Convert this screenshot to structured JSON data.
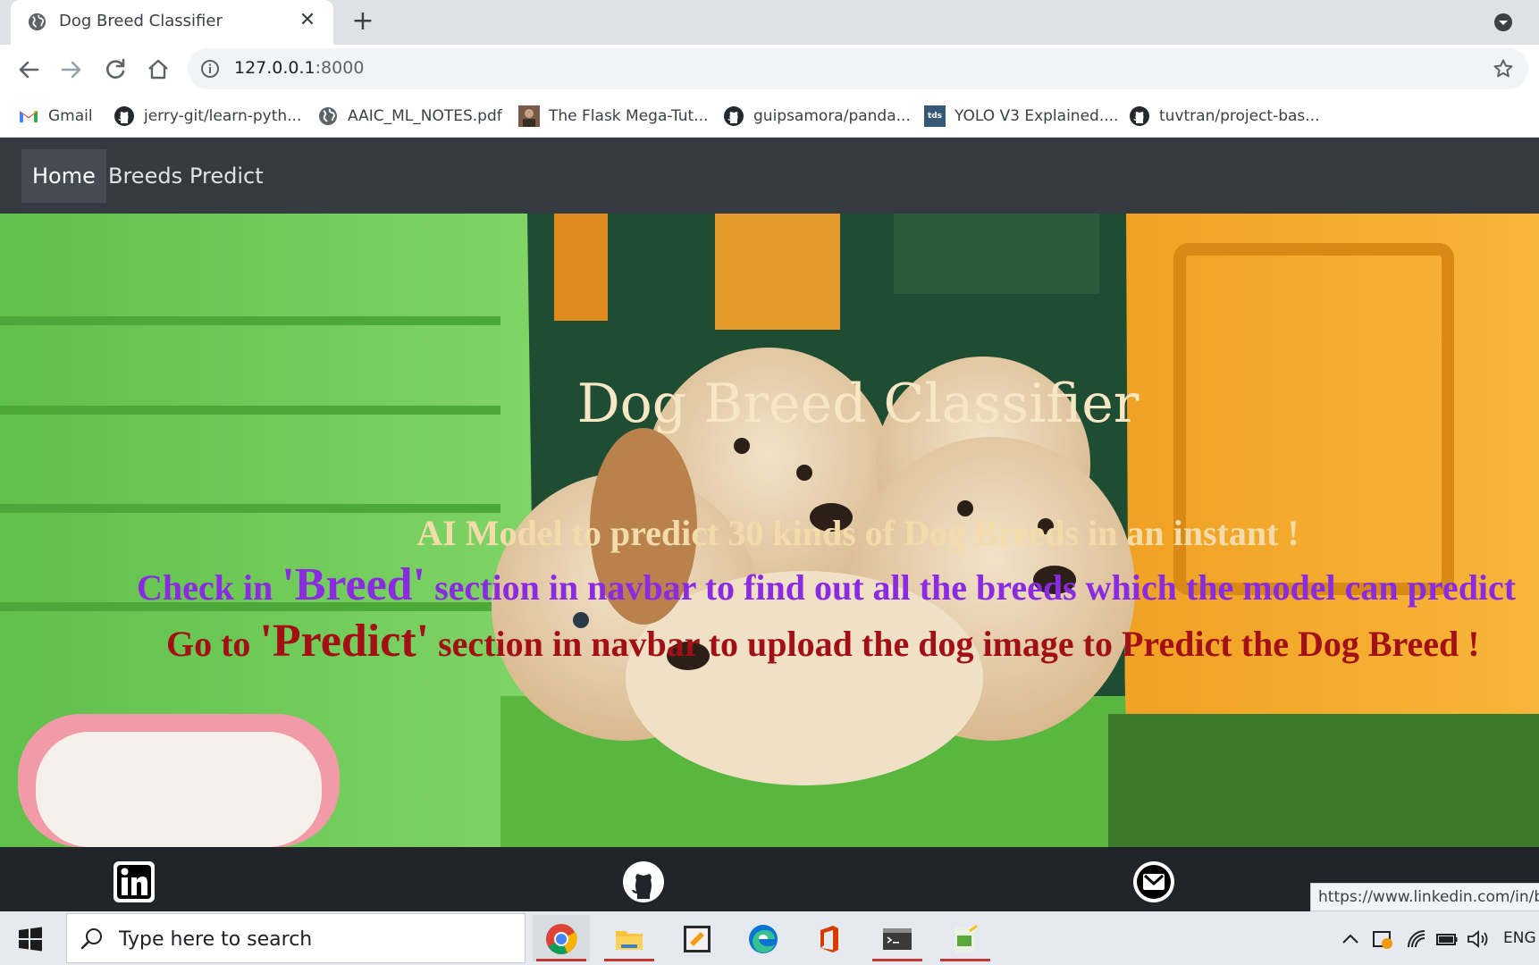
{
  "browser": {
    "tab_title": "Dog Breed Classifier",
    "close_symbol": "✕",
    "newtab_symbol": "+",
    "url_host": "127.0.0.1",
    "url_port": ":8000",
    "bookmarks": [
      {
        "label": "Gmail",
        "icon": "gmail-icon"
      },
      {
        "label": "jerry-git/learn-pyth...",
        "icon": "github-icon"
      },
      {
        "label": "AAIC_ML_NOTES.pdf",
        "icon": "globe-icon"
      },
      {
        "label": "The Flask Mega-Tut...",
        "icon": "avatar-icon"
      },
      {
        "label": "guipsamora/panda...",
        "icon": "github-icon"
      },
      {
        "label": "YOLO V3 Explained....",
        "icon": "tds-icon"
      },
      {
        "label": "tuvtran/project-bas...",
        "icon": "github-icon"
      }
    ],
    "tds_badge": "tds"
  },
  "site": {
    "nav": [
      "Home",
      "Breeds",
      "Predict"
    ],
    "hero": {
      "title": "Dog Breed Classifier",
      "line1": "AI Model to predict 30 kinds of Dog Breeds in an instant !",
      "line2_pre": "Check in ",
      "line2_big": "'Breed'",
      "line2_post": " section in navbar to find out all the breeds which the model can predict",
      "line3_pre": "Go to ",
      "line3_big": "'Predict'",
      "line3_post": " section in navbar to upload the dog image to Predict the Dog Breed !"
    },
    "footer_icons": [
      "linkedin-icon",
      "github-icon",
      "mail-icon"
    ]
  },
  "status_url": "https://www.linkedin.com/in/bh",
  "taskbar": {
    "search_placeholder": "Type here to search",
    "language": "ENG"
  },
  "colors": {
    "navbar_bg": "#343a40",
    "footer_bg": "#212529",
    "title_color": "#f7e7c4",
    "line2_color": "#8a2be2",
    "line3_color": "#a20f14"
  }
}
